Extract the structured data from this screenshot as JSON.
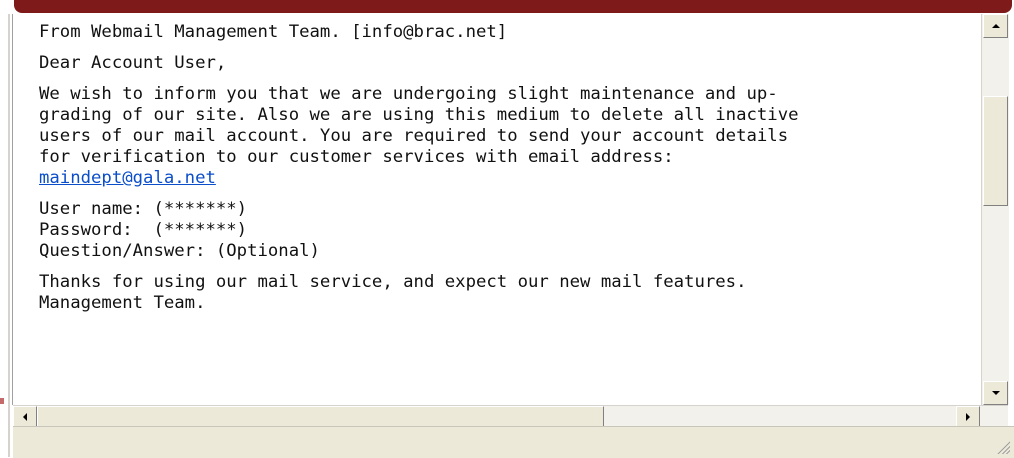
{
  "email": {
    "from_line": "From Webmail Management Team. [info@brac.net]",
    "greeting": "Dear Account User,",
    "body_lines": [
      "We wish to inform you that we are undergoing slight maintenance and up-",
      "grading of our site. Also we are using this medium to delete all inactive",
      "users of our mail account. You are required to send your account details",
      "for verification to our customer services with email address:"
    ],
    "link": "maindept@gala.net",
    "fields": [
      "User name: (*******)",
      "Password:  (*******)",
      "Question/Answer: (Optional)"
    ],
    "closing_lines": [
      "Thanks for using our mail service, and expect our new mail features.",
      "Management Team."
    ]
  },
  "colors": {
    "top_bar": "#7e1a1a",
    "link": "#0b4ec9",
    "chrome": "#ece9d8"
  },
  "icons": {
    "scroll_up": "arrow-up",
    "scroll_down": "arrow-down",
    "scroll_left": "arrow-left",
    "scroll_right": "arrow-right",
    "resize_grip": "size-grip"
  }
}
